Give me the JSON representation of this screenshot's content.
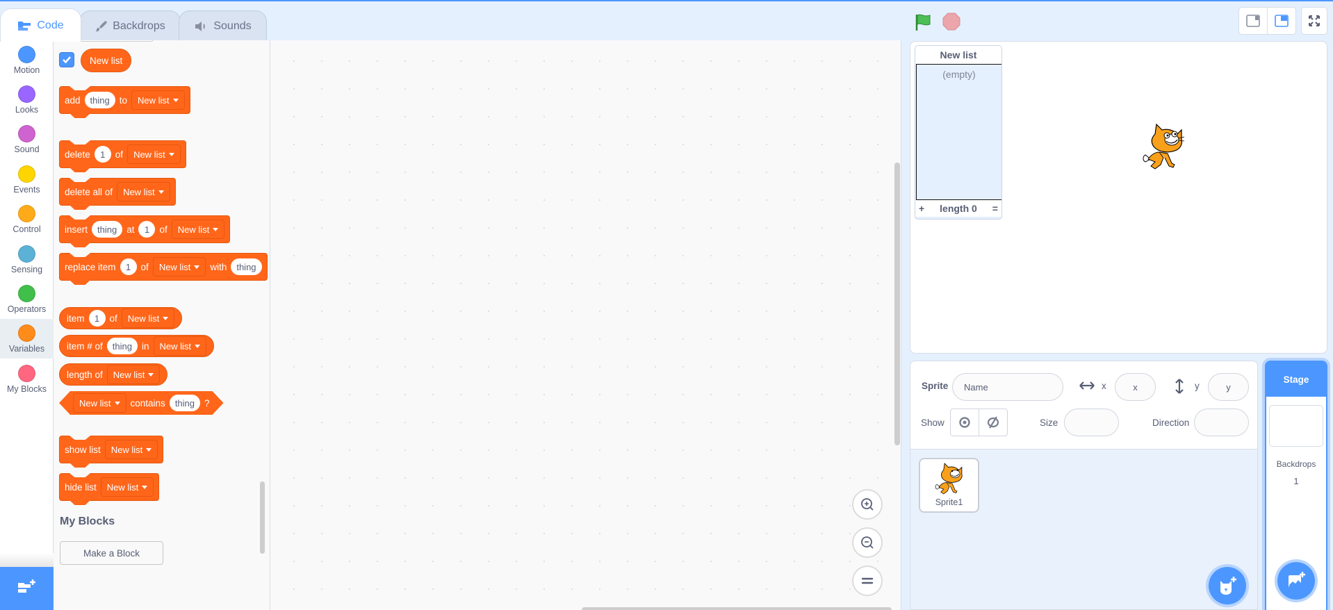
{
  "tabs": [
    {
      "label": "Code",
      "icon": "code-icon",
      "active": true
    },
    {
      "label": "Backdrops",
      "icon": "brush-icon",
      "active": false
    },
    {
      "label": "Sounds",
      "icon": "speaker-icon",
      "active": false
    }
  ],
  "categories": [
    {
      "label": "Motion",
      "color": "#4c97ff"
    },
    {
      "label": "Looks",
      "color": "#9966ff"
    },
    {
      "label": "Sound",
      "color": "#cf63cf"
    },
    {
      "label": "Events",
      "color": "#ffd500"
    },
    {
      "label": "Control",
      "color": "#ffab19"
    },
    {
      "label": "Sensing",
      "color": "#5cb1d6"
    },
    {
      "label": "Operators",
      "color": "#40bf4a"
    },
    {
      "label": "Variables",
      "color": "#ff8c1a",
      "selected": true
    },
    {
      "label": "My Blocks",
      "color": "#ff6680"
    }
  ],
  "flyout": {
    "list_reporter": "New list",
    "list_checked": true,
    "blocks": {
      "add": {
        "t1": "add",
        "v1": "thing",
        "t2": "to",
        "list": "New list"
      },
      "delete": {
        "t1": "delete",
        "v1": "1",
        "t2": "of",
        "list": "New list"
      },
      "delete_all": {
        "t1": "delete all of",
        "list": "New list"
      },
      "insert": {
        "t1": "insert",
        "v1": "thing",
        "t2": "at",
        "v2": "1",
        "t3": "of",
        "list": "New list"
      },
      "replace": {
        "t1": "replace item",
        "v1": "1",
        "t2": "of",
        "list": "New list",
        "t3": "with",
        "v2": "thing"
      },
      "item": {
        "t1": "item",
        "v1": "1",
        "t2": "of",
        "list": "New list"
      },
      "item_num": {
        "t1": "item # of",
        "v1": "thing",
        "t2": "in",
        "list": "New list"
      },
      "length": {
        "t1": "length of",
        "list": "New list"
      },
      "contains": {
        "list": "New list",
        "t1": "contains",
        "v1": "thing",
        "t2": "?"
      },
      "show": {
        "t1": "show list",
        "list": "New list"
      },
      "hide": {
        "t1": "hide list",
        "list": "New list"
      }
    },
    "my_blocks_heading": "My Blocks",
    "make_block_label": "Make a Block"
  },
  "stage": {
    "list_monitor": {
      "title": "New list",
      "empty_text": "(empty)",
      "add": "+",
      "length_label": "length 0",
      "resize": "="
    }
  },
  "sprite_info": {
    "sprite_label": "Sprite",
    "name_placeholder": "Name",
    "x_label": "x",
    "x_placeholder": "x",
    "y_label": "y",
    "y_placeholder": "y",
    "show_label": "Show",
    "size_label": "Size",
    "direction_label": "Direction"
  },
  "sprites": [
    {
      "name": "Sprite1"
    }
  ],
  "stage_pane": {
    "title": "Stage",
    "backdrops_label": "Backdrops",
    "backdrops_count": "1"
  },
  "colors": {
    "accent": "#4c97ff",
    "variables": "#ff661a"
  }
}
